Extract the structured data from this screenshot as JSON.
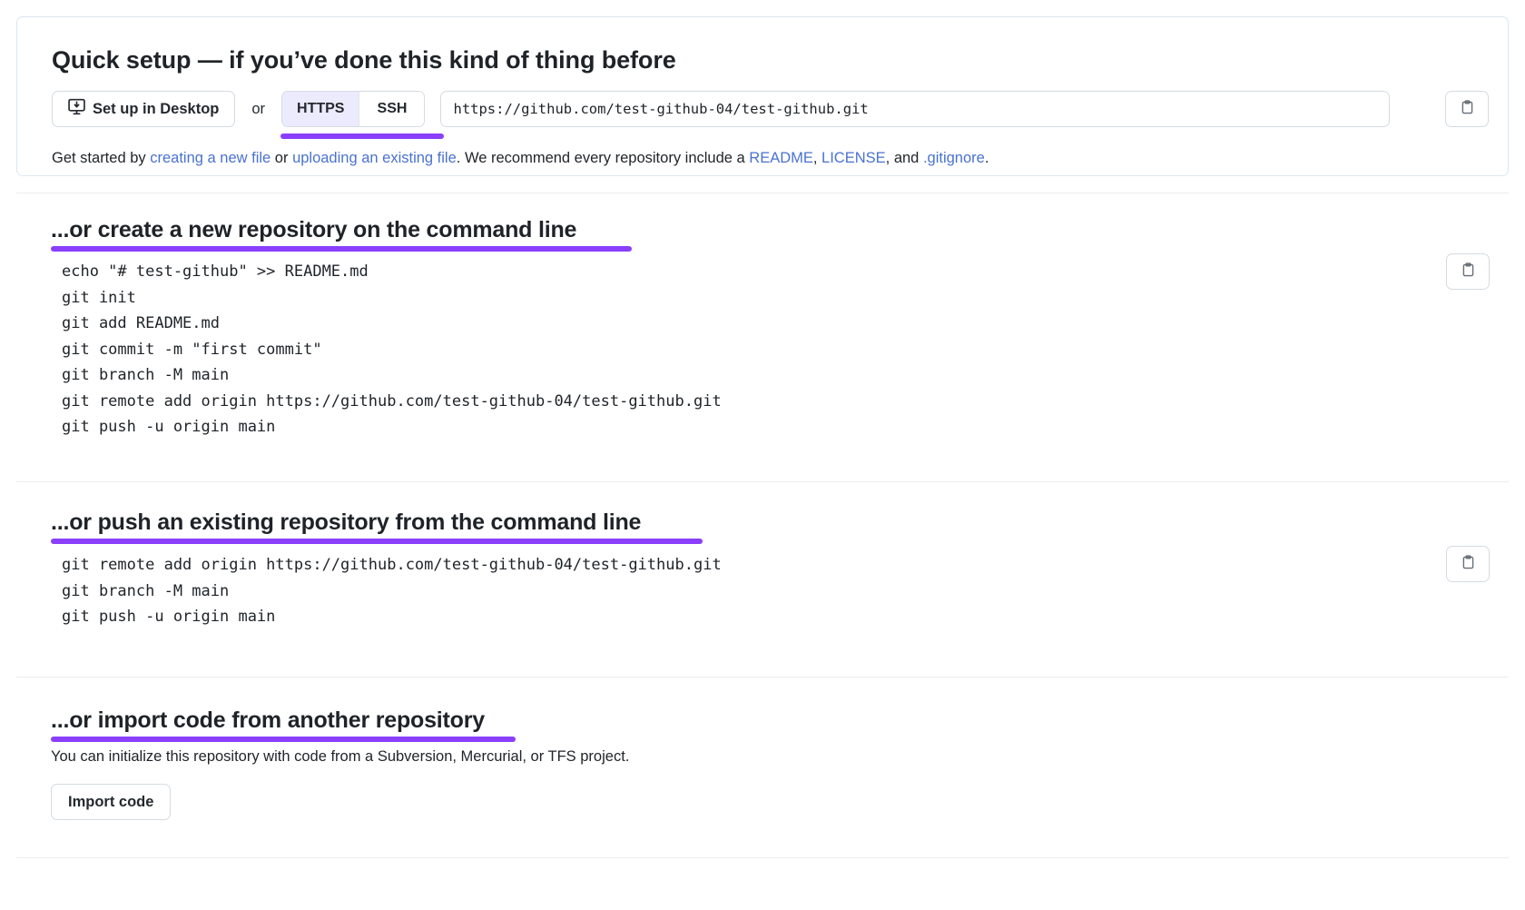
{
  "quick_setup": {
    "title": "Quick setup — if you’ve done this kind of thing before",
    "desktop_button_label": "Set up in Desktop",
    "or_label": "or",
    "protocols": [
      {
        "label": "HTTPS",
        "selected": true
      },
      {
        "label": "SSH",
        "selected": false
      }
    ],
    "remote_url": "https://github.com/test-github-04/test-github.git",
    "copy_icon": "clipboard-icon",
    "desktop_icon": "desktop-download-icon",
    "get_started": {
      "prefix": "Get started by ",
      "link_create": "creating a new file",
      "mid_1": " or ",
      "link_upload": "uploading an existing file",
      "mid_2": ". We recommend every repository include a ",
      "link_readme": "README",
      "sep_1": ", ",
      "link_license": "LICENSE",
      "sep_2": ", and ",
      "link_gitignore": ".gitignore",
      "suffix": "."
    }
  },
  "section_create": {
    "heading": "...or create a new repository on the command line",
    "copy_icon": "clipboard-icon",
    "lines": [
      "echo \"# test-github\" >> README.md",
      "git init",
      "git add README.md",
      "git commit -m \"first commit\"",
      "git branch -M main",
      "git remote add origin https://github.com/test-github-04/test-github.git",
      "git push -u origin main"
    ]
  },
  "section_push": {
    "heading": "...or push an existing repository from the command line",
    "copy_icon": "clipboard-icon",
    "lines": [
      "git remote add origin https://github.com/test-github-04/test-github.git",
      "git branch -M main",
      "git push -u origin main"
    ]
  },
  "section_import": {
    "heading": "...or import code from another repository",
    "description": "You can initialize this repository with code from a Subversion, Mercurial, or TFS project.",
    "import_button_label": "Import code"
  },
  "colors": {
    "accent_purple": "#8a3ffc",
    "link_blue": "#4a72d0",
    "text": "#1f2328",
    "panel_border": "#dde6f2",
    "toggle_active_bg": "#eceafd"
  }
}
